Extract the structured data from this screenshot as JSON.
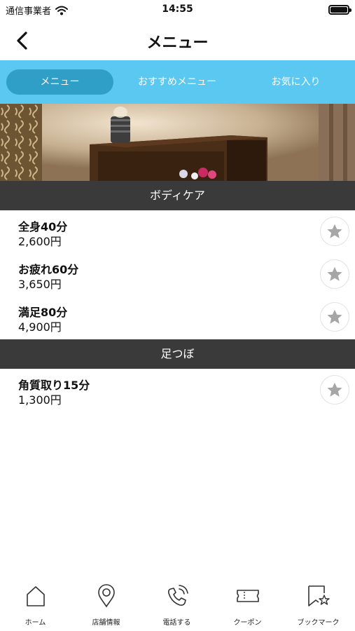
{
  "status_bar": {
    "carrier": "通信事業者",
    "time": "14:55",
    "icons": [
      "wifi-icon",
      "battery-icon"
    ]
  },
  "nav": {
    "title": "メニュー",
    "back_icon": "chevron-left-icon"
  },
  "tabs": [
    {
      "label": "メニュー",
      "active": true
    },
    {
      "label": "おすすめメニュー",
      "active": false
    },
    {
      "label": "お気に入り",
      "active": false
    }
  ],
  "sections": [
    {
      "title": "ボディケア",
      "items": [
        {
          "name": "全身40分",
          "price": "2,600円"
        },
        {
          "name": "お疲れ60分",
          "price": "3,650円"
        },
        {
          "name": "満足80分",
          "price": "4,900円"
        }
      ]
    },
    {
      "title": "足つぼ",
      "items": [
        {
          "name": "角質取り15分",
          "price": "1,300円"
        }
      ]
    }
  ],
  "tab_bar": [
    {
      "label": "ホーム",
      "icon": "home-icon"
    },
    {
      "label": "店舗情報",
      "icon": "location-pin-icon"
    },
    {
      "label": "電話する",
      "icon": "phone-icon"
    },
    {
      "label": "クーポン",
      "icon": "ticket-icon"
    },
    {
      "label": "ブックマーク",
      "icon": "bookmark-star-icon"
    }
  ],
  "colors": {
    "tab_strip": "#5ac8f0",
    "tab_active": "#2f9fc8",
    "section_header": "#3a3a3a",
    "star": "#a6a6a6"
  }
}
